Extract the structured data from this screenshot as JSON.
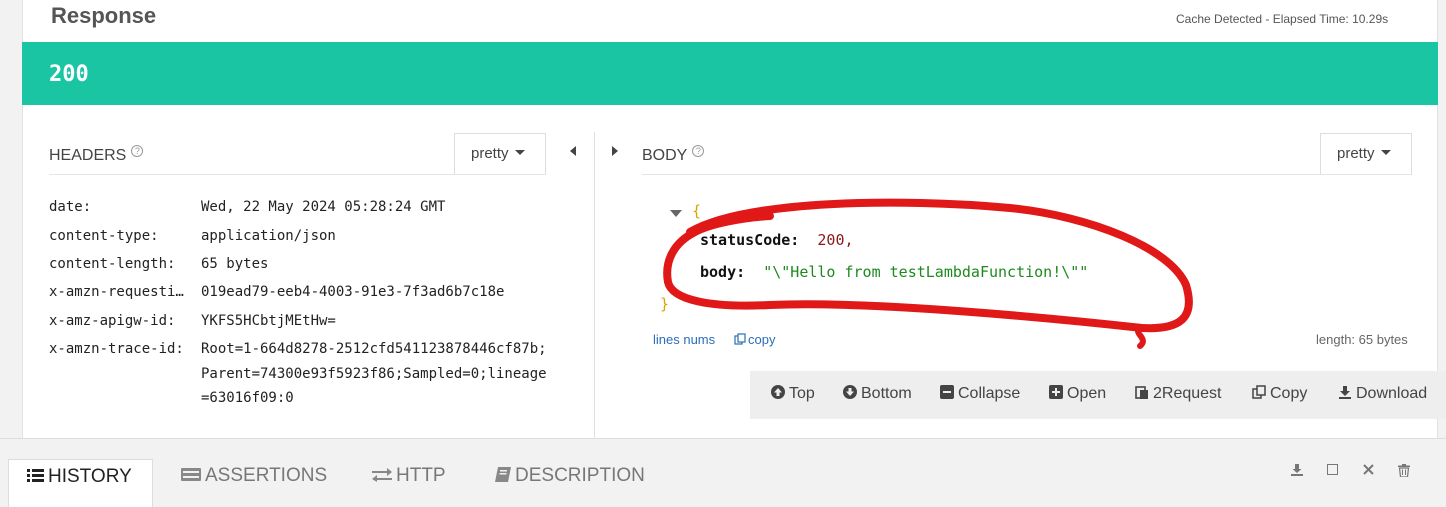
{
  "response": {
    "title": "Response",
    "cache_info": "Cache Detected - Elapsed Time: 10.29s",
    "status_code": "200",
    "status_color": "#1ac5a4"
  },
  "headers_pane": {
    "title": "HEADERS",
    "help_icon": "?",
    "format_label": "pretty",
    "rows": [
      {
        "key": "date:",
        "value": "Wed, 22 May 2024 05:28:24 GMT"
      },
      {
        "key": "content-type:",
        "value": "application/json"
      },
      {
        "key": "content-length:",
        "value": "65 bytes"
      },
      {
        "key": "x-amzn-requesti…",
        "value": "019ead79-eeb4-4003-91e3-7f3ad6b7c18e"
      },
      {
        "key": "x-amz-apigw-id:",
        "value": "YKFS5HCbtjMEtHw="
      },
      {
        "key": "x-amzn-trace-id:",
        "value": "Root=1-664d8278-2512cfd541123878446cf87b;Parent=74300e93f5923f86;Sampled=0;lineage=63016f09:0"
      }
    ]
  },
  "body_pane": {
    "title": "BODY",
    "help_icon": "?",
    "format_label": "pretty",
    "json": {
      "open_brace": "{",
      "close_brace": "}",
      "status_key": "statusCode:",
      "status_value": "200,",
      "body_key": "body:",
      "body_value": "\"\\\"Hello from testLambdaFunction!\\\"\""
    },
    "lines_nums_label": "lines nums",
    "copy_label": "copy",
    "length_label": "length: 65 bytes",
    "annotation_color": "#e01818"
  },
  "toolbar": {
    "top": "Top",
    "bottom": "Bottom",
    "collapse": "Collapse",
    "open": "Open",
    "to_request": "2Request",
    "copy": "Copy",
    "download": "Download"
  },
  "bottom_tabs": {
    "history": "HISTORY",
    "assertions": "ASSERTIONS",
    "http": "HTTP",
    "description": "DESCRIPTION"
  },
  "icons": [
    "help-icon",
    "caret-down-icon",
    "collapse-left-icon",
    "expand-right-icon",
    "arrow-up-icon",
    "arrow-down-icon",
    "minus-icon",
    "plus-icon",
    "clipboard-icon",
    "copy-icon",
    "download-icon",
    "list-icon",
    "assertions-icon",
    "exchange-icon",
    "book-icon",
    "window-icon",
    "close-icon",
    "trash-icon"
  ]
}
